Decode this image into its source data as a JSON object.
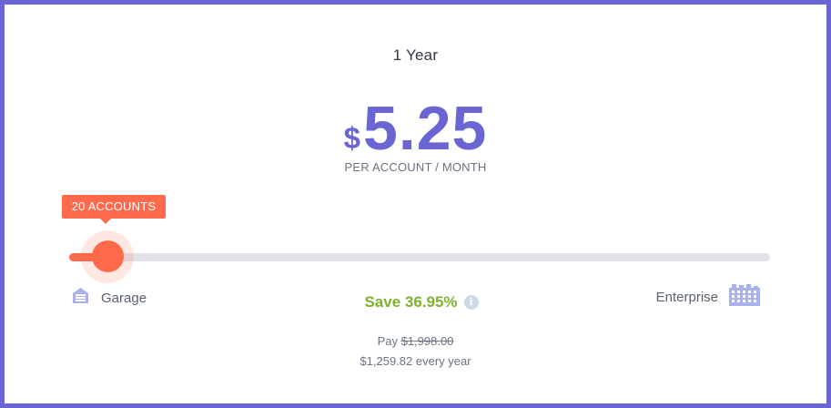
{
  "plan": {
    "term": "1 Year",
    "currency_symbol": "$",
    "price": "5.25",
    "per_unit": "PER ACCOUNT / MONTH"
  },
  "slider": {
    "tooltip": "20 ACCOUNTS",
    "fill_fraction": 0.055,
    "min_label": "Garage",
    "min_icon": "garage-icon",
    "max_label": "Enterprise",
    "max_icon": "building-icon"
  },
  "savings": {
    "label": "Save 36.95%",
    "info_icon": "info-icon"
  },
  "billing": {
    "pay_prefix": "Pay ",
    "original_price": "$1,998.00",
    "yearly": "$1,259.82 every year"
  },
  "colors": {
    "accent": "#6a65d3",
    "slider": "#ff6a4c",
    "savings": "#7bb32e",
    "tier_icon": "#a9b2ee"
  }
}
